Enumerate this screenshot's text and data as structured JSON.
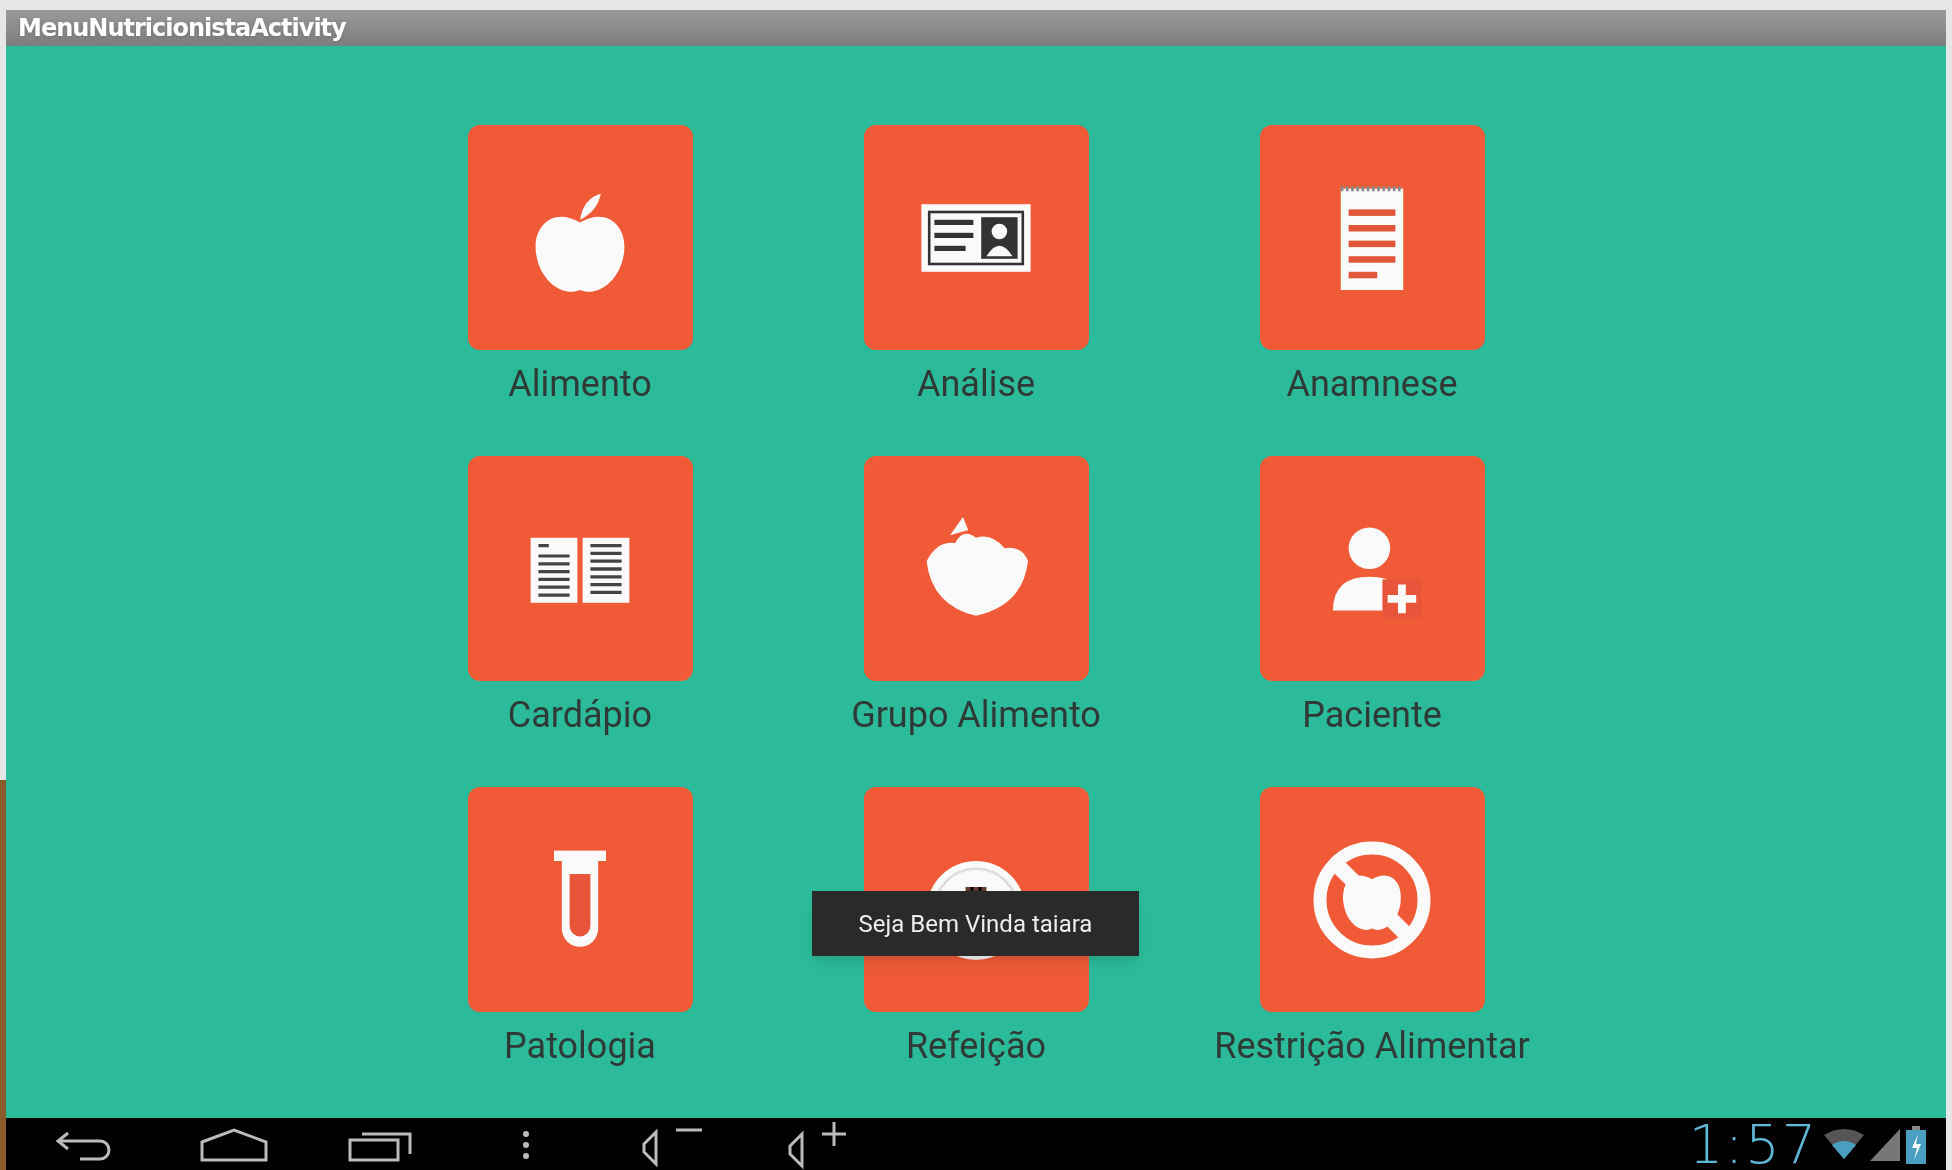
{
  "window": {
    "title": "MenuNutricionistaActivity"
  },
  "tiles": [
    {
      "kind": "apple",
      "label": "Alimento"
    },
    {
      "kind": "idcard",
      "label": "Análise"
    },
    {
      "kind": "notepad",
      "label": "Anamnese"
    },
    {
      "kind": "book",
      "label": "Cardápio"
    },
    {
      "kind": "bowl",
      "label": "Grupo Alimento"
    },
    {
      "kind": "patient",
      "label": "Paciente"
    },
    {
      "kind": "tube",
      "label": "Patologia"
    },
    {
      "kind": "plate",
      "label": "Refeição"
    },
    {
      "kind": "forbidden",
      "label": "Restrição Alimentar"
    }
  ],
  "toast": "Seja Bem Vinda taiara",
  "status_bar": {
    "time": "1:57"
  }
}
